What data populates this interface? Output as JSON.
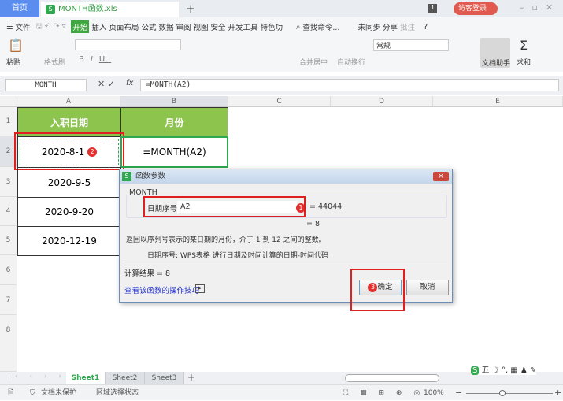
{
  "tabs": {
    "home": "首页",
    "file": "MONTH函数.xls",
    "new": "+",
    "login": "访客登录",
    "count": "1"
  },
  "menu": {
    "file": "文件",
    "items": [
      "开始",
      "插入",
      "页面布局",
      "公式",
      "数据",
      "审阅",
      "视图",
      "安全",
      "开发工具",
      "特色功"
    ],
    "search": "查找命令...",
    "sync": "未同步",
    "share": "分享",
    "comment": "批注",
    "help": "?"
  },
  "ribbon": {
    "paste": "粘贴",
    "format_painter": "格式刷",
    "merge": "合并居中",
    "wrap": "自动换行",
    "number_format": "常规",
    "doc_helper": "文档助手",
    "sum": "求和",
    "bold": "B",
    "italic": "I",
    "underline": "U"
  },
  "formula_bar": {
    "name_box": "MONTH",
    "fx": "fx",
    "formula": "=MONTH(A2)"
  },
  "columns": [
    "A",
    "B",
    "C",
    "D",
    "E"
  ],
  "rows": [
    "1",
    "2",
    "3",
    "4",
    "5",
    "6",
    "7",
    "8"
  ],
  "cells": {
    "a1": "入职日期",
    "b1": "月份",
    "a2": "2020-8-1",
    "b2": "=MONTH(A2)",
    "a3": "2020-9-5",
    "a4": "2020-9-20",
    "a5": "2020-12-19"
  },
  "badges": {
    "one": "1",
    "two": "2",
    "three": "3"
  },
  "dialog": {
    "title": "函数参数",
    "func": "MONTH",
    "arg_label": "日期序号",
    "arg_value": "A2",
    "arg_result": "= 44044",
    "result_eq": "= 8",
    "description": "返回以序列号表示的某日期的月份，介于 1 到 12 之间的整数。",
    "arg_desc": "日期序号:  WPS表格 进行日期及时间计算的日期-时间代码",
    "calc_result": "计算结果 =  8",
    "help_link": "查看该函数的操作技巧",
    "ok": "确定",
    "cancel": "取消",
    "close": "×"
  },
  "sheets": [
    "Sheet1",
    "Sheet2",
    "Sheet3"
  ],
  "status": {
    "protect": "文档未保护",
    "mode": "区域选择状态",
    "zoom": "100%"
  }
}
